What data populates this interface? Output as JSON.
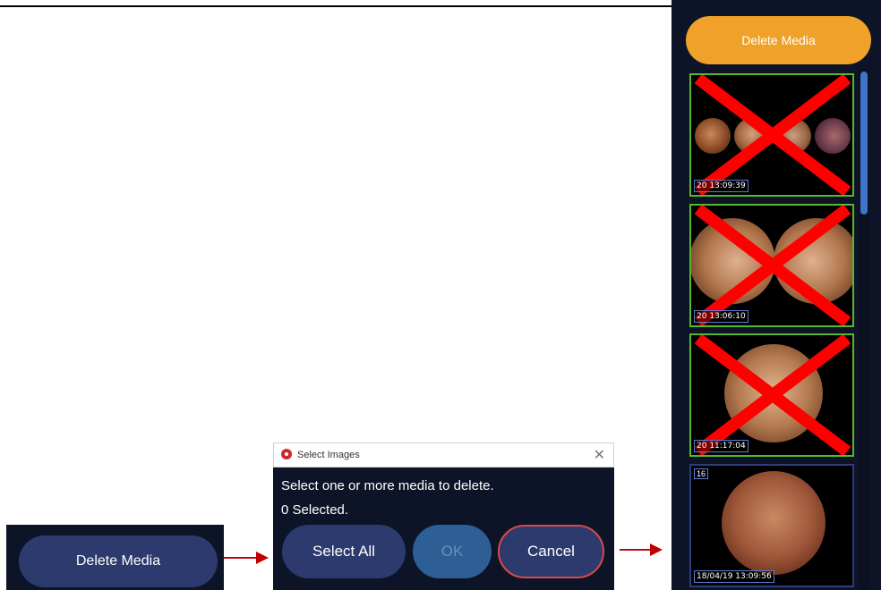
{
  "left_panel": {
    "delete_button_label": "Delete Media"
  },
  "dialog": {
    "title": "Select Images",
    "close_glyph": "✕",
    "message": "Select one or more media to delete.",
    "selected_count_text": "0 Selected.",
    "buttons": {
      "select_all": "Select All",
      "ok": "OK",
      "cancel": "Cancel"
    }
  },
  "right_panel": {
    "delete_button_label": "Delete Media",
    "thumbnails": [
      {
        "timestamp": "20 13:09:39",
        "selected": true
      },
      {
        "timestamp": "20 13:06:10",
        "selected": true
      },
      {
        "timestamp": "20 11:17:04",
        "selected": true
      },
      {
        "timestamp": "18/04/19 13:09:56",
        "index": "16",
        "selected": false
      }
    ]
  },
  "colors": {
    "panel_bg": "#0e1427",
    "button_blue": "#2c3a6d",
    "accent_orange": "#f0a12a",
    "selected_border": "#58b82a",
    "x_red": "#ff0000",
    "arrow_red": "#c00000"
  }
}
